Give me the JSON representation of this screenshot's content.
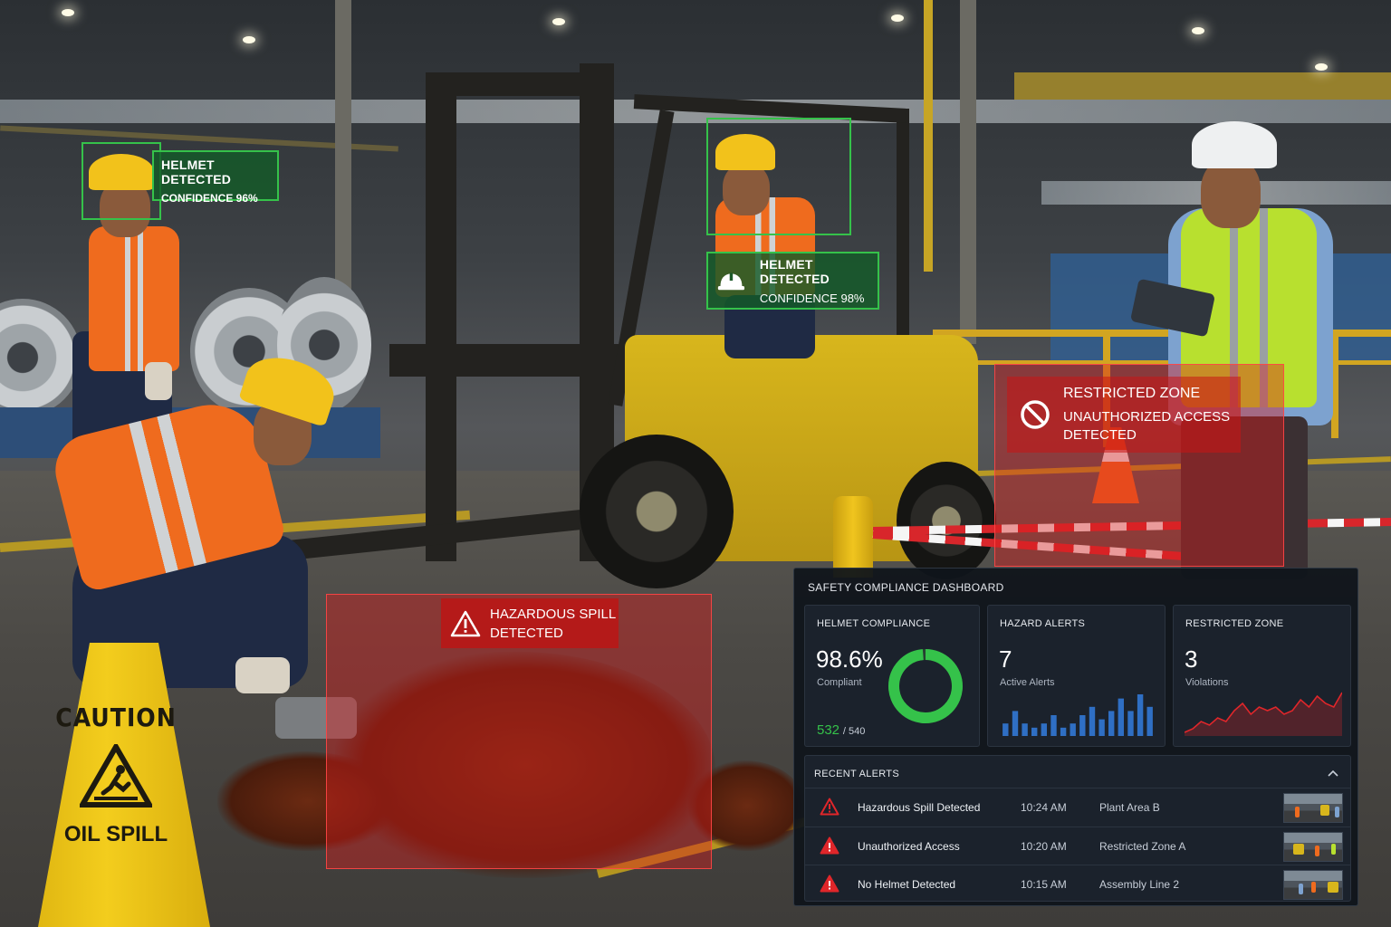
{
  "scene": {
    "caution_sign": {
      "line1": "CAUTION",
      "line2": "OIL SPILL",
      "icon": "slippery-floor-icon"
    }
  },
  "detections": {
    "helmet_left": {
      "label": "HELMET DETECTED",
      "confidence": "CONFIDENCE 96%"
    },
    "helmet_driver": {
      "label": "HELMET DETECTED",
      "confidence": "CONFIDENCE 98%",
      "icon": "hard-hat-icon"
    },
    "restricted_zone": {
      "title": "RESTRICTED ZONE",
      "line2": "UNAUTHORIZED ACCESS",
      "line3": "DETECTED",
      "icon": "no-entry-icon"
    },
    "spill": {
      "line1": "HAZARDOUS SPILL",
      "line2": "DETECTED",
      "icon": "warning-triangle-icon"
    }
  },
  "dashboard": {
    "title": "SAFETY COMPLIANCE DASHBOARD",
    "helmet": {
      "title": "HELMET COMPLIANCE",
      "value": "98.6%",
      "sub": "Compliant",
      "count": "532",
      "total": "/ 540",
      "fraction": 0.986
    },
    "hazard": {
      "title": "HAZARD ALERTS",
      "value": "7",
      "sub": "Active Alerts",
      "bars": [
        3,
        6,
        3,
        2,
        3,
        5,
        2,
        3,
        5,
        7,
        4,
        6,
        9,
        6,
        10,
        7
      ]
    },
    "restricted": {
      "title": "RESTRICTED ZONE",
      "value": "3",
      "sub": "Violations",
      "trend": [
        2,
        3,
        5,
        4,
        6,
        5,
        8,
        10,
        7,
        9,
        8,
        9,
        7,
        8,
        11,
        9,
        12,
        10,
        9,
        13
      ]
    },
    "recent": {
      "title": "RECENT ALERTS",
      "rows": [
        {
          "name": "Hazardous Spill Detected",
          "time": "10:24 AM",
          "location": "Plant Area B"
        },
        {
          "name": "Unauthorized Access",
          "time": "10:20 AM",
          "location": "Restricted Zone A"
        },
        {
          "name": "No Helmet Detected",
          "time": "10:15 AM",
          "location": "Assembly Line 2"
        }
      ]
    },
    "colors": {
      "accent_green": "#35c24a",
      "alert_red": "#e0262a",
      "bar_blue": "#2f6fc4"
    }
  }
}
